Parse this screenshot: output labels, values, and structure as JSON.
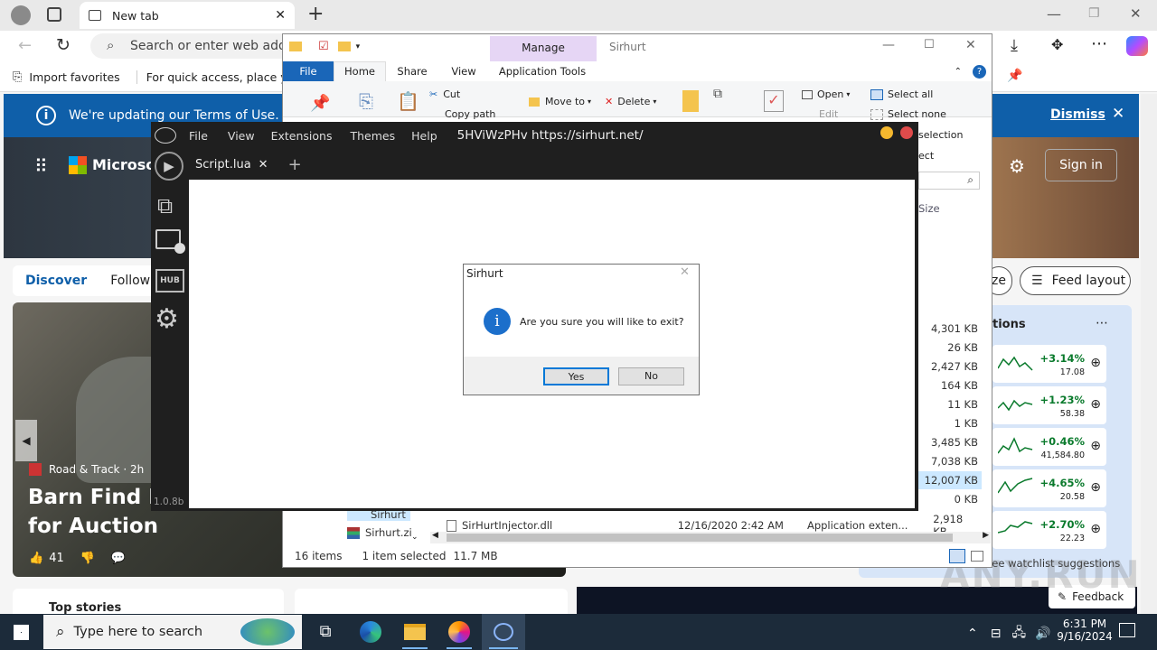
{
  "browser": {
    "tab_title": "New tab",
    "address_placeholder": "Search or enter web addres",
    "favorites": [
      "Import favorites",
      "For quick access, place your favo"
    ],
    "banner_text": "We're updating our Terms of Use.",
    "banner_dismiss": "Dismiss",
    "ms_brand": "Microsoft",
    "sign_in": "Sign in",
    "feed_tabs": [
      "Discover",
      "Following"
    ],
    "feed_layout": "Feed layout",
    "personalize_partial": "ze",
    "story_source": "Road & Track · 2h",
    "story_title": "Barn Find Ho",
    "story_title2": "for Auction",
    "story_likes": "41",
    "watchlist_title_partial": "tions",
    "stocks": [
      {
        "change": "+3.14%",
        "price": "17.08"
      },
      {
        "change": "+1.23%",
        "price": "58.38"
      },
      {
        "change": "+0.46%",
        "price": "41,584.80"
      },
      {
        "change": "+4.65%",
        "price": "20.58"
      },
      {
        "change": "+2.70%",
        "price": "22.23"
      }
    ],
    "watchlist_suggestions": "See watchlist suggestions",
    "top_stories": "Top stories",
    "feedback": "Feedback"
  },
  "explorer": {
    "title": "Sirhurt",
    "context_tab": "Manage",
    "tabs": [
      "File",
      "Home",
      "Share",
      "View",
      "Application Tools"
    ],
    "ribbon": {
      "cut": "Cut",
      "copy_path": "Copy path",
      "move_to": "Move to",
      "delete": "Delete",
      "open": "Open",
      "edit": "Edit",
      "select_all": "Select all",
      "select_none": "Select none",
      "invert_selection": "selection",
      "select_partial": "ect"
    },
    "col_size": "Size",
    "sizes": [
      "4,301 KB",
      "26 KB",
      "2,427 KB",
      "164 KB",
      "11 KB",
      "1 KB",
      "3,485 KB",
      "7,038 KB",
      "12,007 KB",
      "0 KB",
      "2,918 KB"
    ],
    "sidebar_items": [
      "Sirhurt",
      "Sirhurt.zi"
    ],
    "file_row": {
      "name": "SirHurtInjector.dll",
      "date": "12/16/2020 2:42 AM",
      "type": "Application exten...",
      "size": "2,918 KB"
    },
    "status_items": "16 items",
    "status_selected": "1 item selected",
    "status_size": "11.7 MB"
  },
  "sirhurt": {
    "menu": [
      "File",
      "View",
      "Extensions",
      "Themes",
      "Help"
    ],
    "title_text": "5HViWzPHv https://sirhurt.net/",
    "tab_label": "Script.lua",
    "version": "1.0.8b"
  },
  "dialog": {
    "title": "Sirhurt",
    "message": "Are you sure you will like to exit?",
    "yes": "Yes",
    "no": "No"
  },
  "taskbar": {
    "search_placeholder": "Type here to search",
    "time": "6:31 PM",
    "date": "9/16/2024"
  },
  "watermark": "ANY.RUN"
}
